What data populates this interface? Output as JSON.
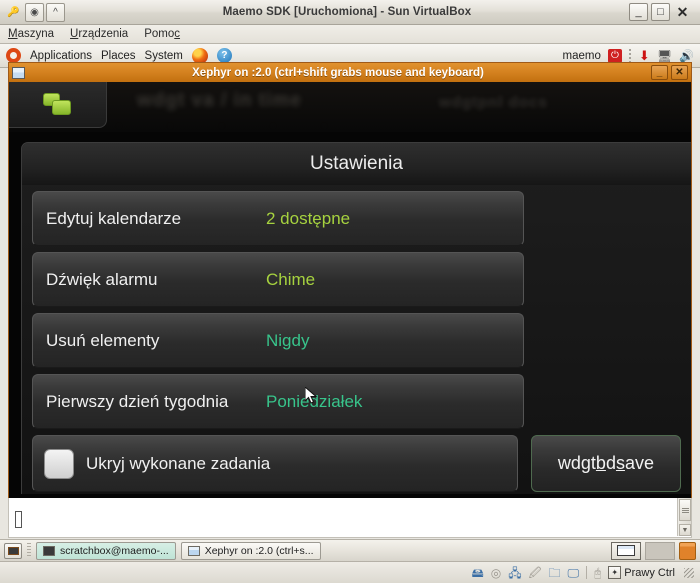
{
  "vbox": {
    "title": "Maemo SDK [Uruchomiona] - Sun VirtualBox",
    "menus": [
      "Maszyna",
      "Urządzenia",
      "Pomoc"
    ],
    "window_buttons": {
      "minimize": "_",
      "maximize": "□",
      "close": "✕"
    },
    "status": {
      "host_key": "Prawy Ctrl",
      "icons": [
        "hdd-icon",
        "cd-icon",
        "network-icon",
        "usb-icon",
        "folder-icon",
        "display-icon",
        "mouse-icon"
      ]
    }
  },
  "gnome_panel": {
    "menus": [
      "Applications",
      "Places",
      "System"
    ],
    "user": "maemo",
    "icons": [
      "ubuntu-logo-icon",
      "firefox-icon",
      "help-icon",
      "power-icon",
      "update-icon",
      "network-icon",
      "volume-icon"
    ]
  },
  "xephyr": {
    "title": "Xephyr on :2.0 (ctrl+shift grabs mouse and keyboard)",
    "buttons": {
      "minimize": "_",
      "close": "✕"
    }
  },
  "maemo": {
    "background": {
      "blur_line_1": "wdgt va / in time",
      "blur_line_2": "wdgtpnl docs",
      "blur_row": "· · · · ·"
    },
    "dialog": {
      "title": "Ustawienia",
      "rows": [
        {
          "label": "Edytuj kalendarze",
          "value": "2 dostępne",
          "value_color": "green"
        },
        {
          "label": "Dźwięk alarmu",
          "value": "Chime",
          "value_color": "green"
        },
        {
          "label": "Usuń elementy",
          "value": "Nigdy",
          "value_color": "teal"
        },
        {
          "label": "Pierwszy dzień tygodnia",
          "value": "Poniedziałek",
          "value_color": "teal"
        }
      ],
      "checkbox": {
        "label": "Ukryj wykonane zadania",
        "checked": false
      },
      "save_button": {
        "pre": "wdgt",
        "mn1": "b",
        "mid": "d",
        "mn2": "s",
        "post": "ave",
        "full": "wdgtbdsave"
      }
    },
    "colors": {
      "green": "#a6d23f",
      "teal": "#38c48b",
      "accent": "#c2700f"
    }
  },
  "taskbar": {
    "tasks": [
      {
        "label": "scratchbox@maemo-...",
        "active": true,
        "icon": "terminal-icon"
      },
      {
        "label": "Xephyr on :2.0 (ctrl+s...",
        "active": false,
        "icon": "window-icon"
      }
    ]
  }
}
